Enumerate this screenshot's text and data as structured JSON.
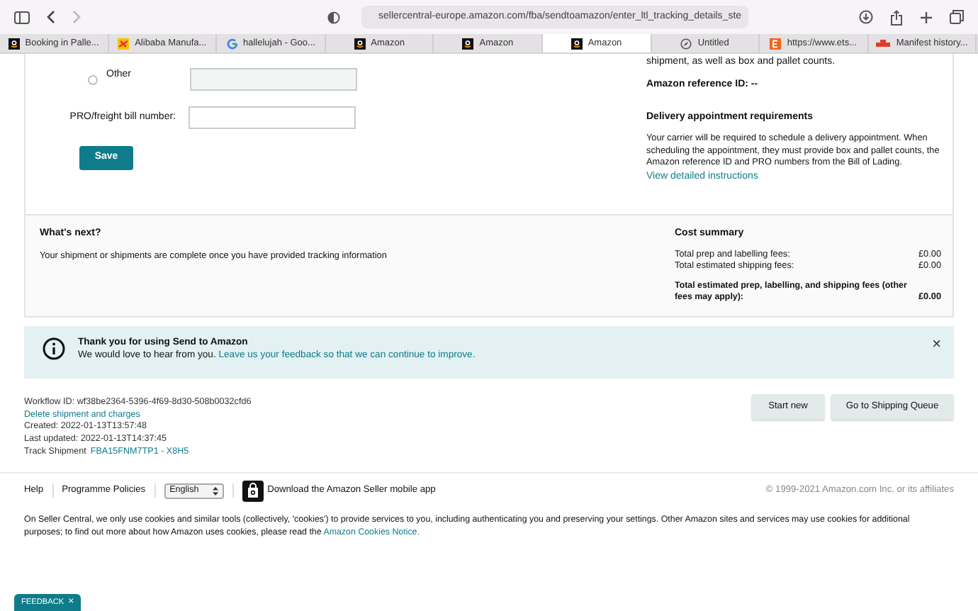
{
  "browser": {
    "url": "sellercentral-europe.amazon.com/fba/sendtoamazon/enter_ltl_tracking_details_ste",
    "tabs": [
      {
        "label": "Booking in Palle...",
        "kind": "amazon",
        "selected": false
      },
      {
        "label": "Alibaba Manufa...",
        "kind": "alibaba",
        "selected": false
      },
      {
        "label": "hallelujah - Goo...",
        "kind": "google",
        "selected": false
      },
      {
        "label": "Amazon",
        "kind": "amazon",
        "selected": false
      },
      {
        "label": "Amazon",
        "kind": "amazon",
        "selected": false
      },
      {
        "label": "Amazon",
        "kind": "amazon",
        "selected": true
      },
      {
        "label": "Untitled",
        "kind": "compass",
        "selected": false
      },
      {
        "label": "https://www.ets...",
        "kind": "etsy",
        "selected": false
      },
      {
        "label": "Manifest history...",
        "kind": "manifest",
        "selected": false
      }
    ]
  },
  "tracking_form": {
    "other_option": {
      "label": "Other",
      "selected": false
    },
    "other_field": {
      "disabled": true
    },
    "pro_label": "PRO/freight bill number:",
    "save_button": "Save"
  },
  "info_column": {
    "top_line": "shipment, as well as box and pallet counts.",
    "reference": "Amazon reference ID: --",
    "appointment_title": "Delivery appointment requirements",
    "appointment_text": "Your carrier will be required to schedule a delivery appointment. When scheduling the appointment, they must provide box and pallet counts, the Amazon reference ID and PRO numbers from the Bill of Lading.",
    "instructions_link": "View detailed instructions"
  },
  "whats_next": {
    "title": "What's next?",
    "text": "Your shipment or shipments are complete once you have provided tracking information"
  },
  "cost_summary": {
    "title": "Cost summary",
    "rows": [
      {
        "label": "Total prep and labelling fees:",
        "value": "£0.00"
      },
      {
        "label": "Total estimated shipping fees:",
        "value": "£0.00"
      }
    ],
    "total_label": "Total estimated prep, labelling, and shipping fees (other fees may apply):",
    "total_value": "£0.00"
  },
  "banner": {
    "title": "Thank you for using Send to Amazon",
    "text": "We would love to hear from you.",
    "link": "Leave us your feedback so that we can continue to improve.",
    "close": "×"
  },
  "workflow": {
    "id": "Workflow ID: wf38be2364-5396-4f69-8d30-508b0032cfd6",
    "delete_link": "Delete shipment and charges",
    "created": "Created: 2022-01-13T13:57:48",
    "updated": "Last updated: 2022-01-13T14:37:45",
    "track_label": "Track Shipment",
    "track_link": "FBA15FNM7TP1 - X8H5"
  },
  "actions": [
    "Start new",
    "Go to Shipping Queue"
  ],
  "footer": {
    "links": [
      "Help",
      "Programme Policies"
    ],
    "language": "English",
    "app_link": "Download the Amazon Seller mobile app",
    "copyright": "© 1999-2021 Amazon.com Inc. or its affiliates"
  },
  "cookies": {
    "text": "On Seller Central, we only use cookies and similar tools (collectively, 'cookies') to provide services to you, including authenticating you and preserving your settings. Other Amazon sites and services may use cookies for additional purposes; to find out more about how Amazon uses cookies, please read the",
    "link": "Amazon Cookies Notice."
  },
  "feedback_button": {
    "label": "FEEDBACK",
    "close": "×"
  }
}
